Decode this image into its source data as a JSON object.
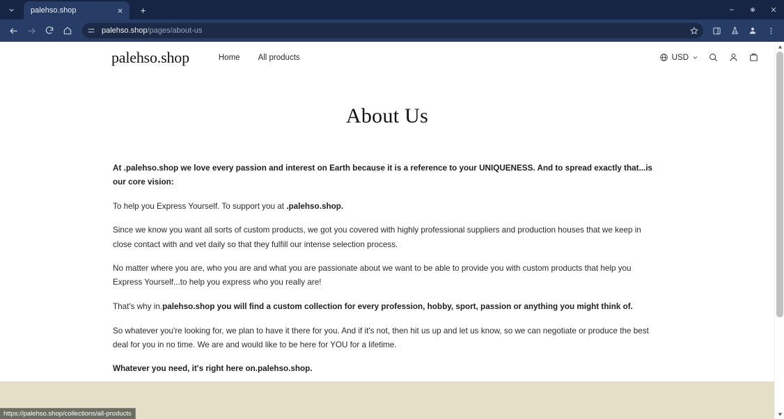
{
  "browser": {
    "tab_list_icon": "chevron-down-icon",
    "tabs": [
      {
        "title": "palehso.shop",
        "close_icon": "close-icon"
      }
    ],
    "new_tab_label": "+",
    "window_controls": {
      "minimize": "minimize-icon",
      "maximize": "maximize-icon",
      "close": "close-icon"
    },
    "toolbar": {
      "back_icon": "arrow-left-icon",
      "forward_icon": "arrow-right-icon",
      "reload_icon": "reload-icon",
      "home_icon": "home-icon",
      "site_settings_icon": "tune-sliders-icon",
      "bookmark_icon": "star-icon",
      "side_panel_icon": "side-panel-icon",
      "experiments_icon": "flask-icon",
      "profile_icon": "person-icon",
      "menu_icon": "three-dots-vertical-icon"
    },
    "address": {
      "host": "palehso.shop",
      "path": "/pages/about-us"
    },
    "status_bubble": "https://palehso.shop/collections/all-products"
  },
  "site": {
    "logo": "palehso.shop",
    "nav": [
      {
        "label": "Home"
      },
      {
        "label": "All products"
      }
    ],
    "header_right": {
      "globe_icon": "globe-icon",
      "currency": "USD",
      "currency_chevron_icon": "chevron-down-icon",
      "search_icon": "search-icon",
      "account_icon": "person-icon",
      "cart_icon": "cart-icon"
    }
  },
  "main": {
    "title": "About Us",
    "paragraphs": [
      {
        "style": "strong",
        "text": "At .palehso.shop we love every passion and interest on Earth because it is a reference to your UNIQUENESS. And to spread exactly that...is our core vision:"
      },
      {
        "style": "mixed",
        "lead": "To help you Express Yourself. To support you at ",
        "bold": ".palehso.shop.",
        "tail": ""
      },
      {
        "style": "normal",
        "text": "Since we know you want all sorts of custom products, we got you covered with highly professional suppliers and production houses that we keep in close contact with and vet daily so that they fulfill our intense selection process."
      },
      {
        "style": "normal",
        "text": "No matter where you are, who you are and what you are passionate about we want to be able to provide you with custom products that help you Express Yourself...to help you express who you really are!"
      },
      {
        "style": "mixed",
        "lead": "That's why in.",
        "bold": "palehso.shop you will find a custom collection for every profession, hobby, sport, passion or anything you might think of.",
        "tail": ""
      },
      {
        "style": "normal",
        "text": "So whatever you're looking for, we plan to have it there for you. And if it's not, then hit us up and let us know, so we can negotiate or produce the best deal for you in no time. We are and would like to be here for YOU for a lifetime."
      },
      {
        "style": "strong",
        "text": "Whatever you need, it's right here on.palehso.shop."
      }
    ]
  },
  "colors": {
    "chrome_bg": "#273d66",
    "tabstrip_bg": "#172544",
    "omnibox_bg": "#1d2a45",
    "footer_band": "#e5dfc7",
    "text": "#2b2b2b"
  }
}
